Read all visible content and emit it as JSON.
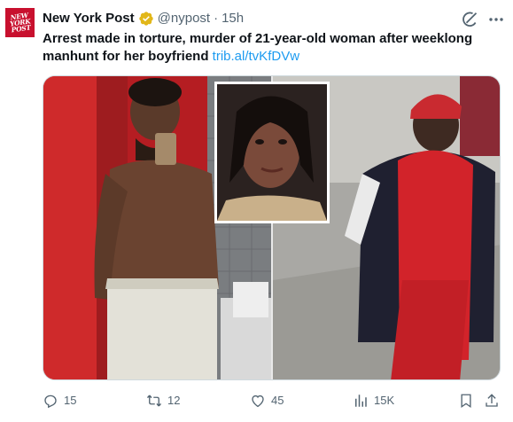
{
  "author": {
    "avatar_text": "NEW\nYORK\nPOST",
    "name": "New York Post",
    "handle": "@nypost",
    "separator": "·",
    "time": "15h",
    "verified_color": "#e2b719"
  },
  "tweet": {
    "text": "Arrest made in torture, murder of 21-year-old woman after weeklong manhunt for her boyfriend",
    "link": "trib.al/tvKfDVw"
  },
  "media": {
    "description_icon": "photo-collage"
  },
  "actions": {
    "reply_count": "15",
    "retweet_count": "12",
    "like_count": "45",
    "views_count": "15K"
  },
  "colors": {
    "brand_red": "#c8102e",
    "link_blue": "#1d9bf0",
    "secondary_text": "#536471"
  }
}
